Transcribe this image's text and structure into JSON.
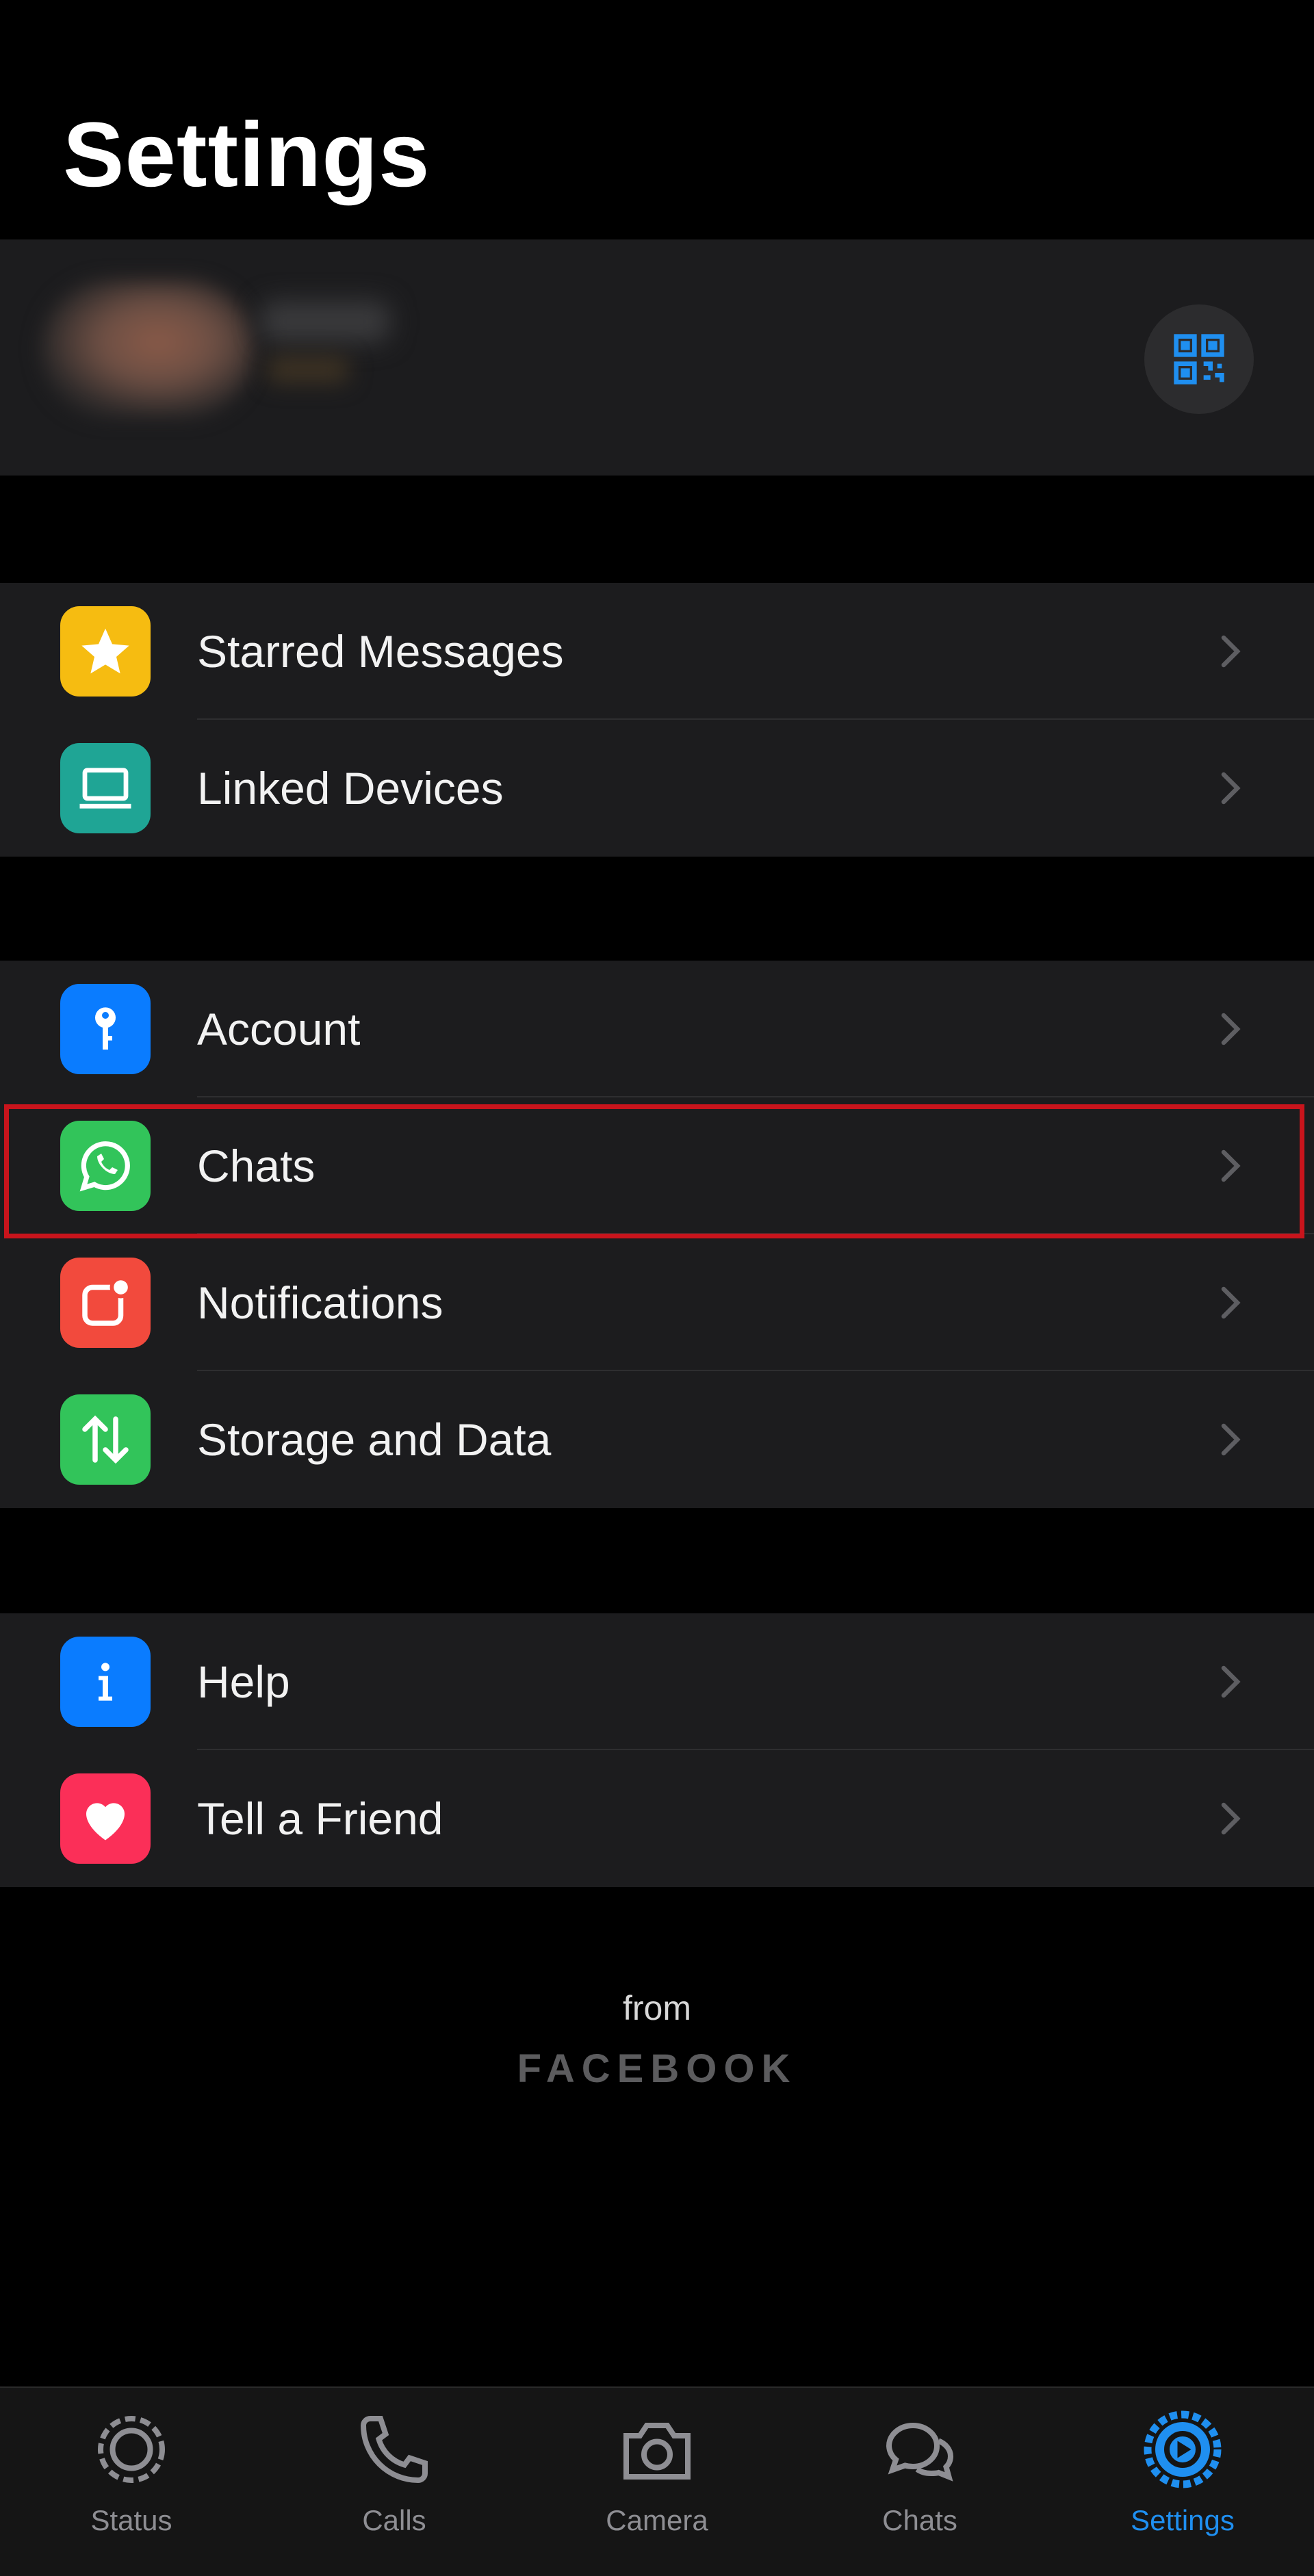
{
  "header": {
    "title": "Settings"
  },
  "profile": {
    "qr_icon": "qr-code-icon"
  },
  "groups": [
    {
      "items": [
        {
          "label": "Starred Messages",
          "icon": "star-icon",
          "color": "#f6bc11"
        },
        {
          "label": "Linked Devices",
          "icon": "laptop-icon",
          "color": "#1fa595"
        }
      ]
    },
    {
      "items": [
        {
          "label": "Account",
          "icon": "key-icon",
          "color": "#0a7cff"
        },
        {
          "label": "Chats",
          "icon": "whatsapp-icon",
          "color": "#32c45a",
          "highlighted": true
        },
        {
          "label": "Notifications",
          "icon": "notification-icon",
          "color": "#f24a3d"
        },
        {
          "label": "Storage and Data",
          "icon": "arrows-updown-icon",
          "color": "#32c45a"
        }
      ]
    },
    {
      "items": [
        {
          "label": "Help",
          "icon": "info-icon",
          "color": "#0a7cff"
        },
        {
          "label": "Tell a Friend",
          "icon": "heart-icon",
          "color": "#fb2f58"
        }
      ]
    }
  ],
  "footer": {
    "from": "from",
    "brand": "FACEBOOK"
  },
  "tabbar": {
    "tabs": [
      {
        "label": "Status",
        "icon": "status-icon",
        "active": false
      },
      {
        "label": "Calls",
        "icon": "phone-icon",
        "active": false
      },
      {
        "label": "Camera",
        "icon": "camera-icon",
        "active": false
      },
      {
        "label": "Chats",
        "icon": "chats-icon",
        "active": false
      },
      {
        "label": "Settings",
        "icon": "settings-gear-icon",
        "active": true
      }
    ],
    "active_color": "#1f8ff0"
  }
}
